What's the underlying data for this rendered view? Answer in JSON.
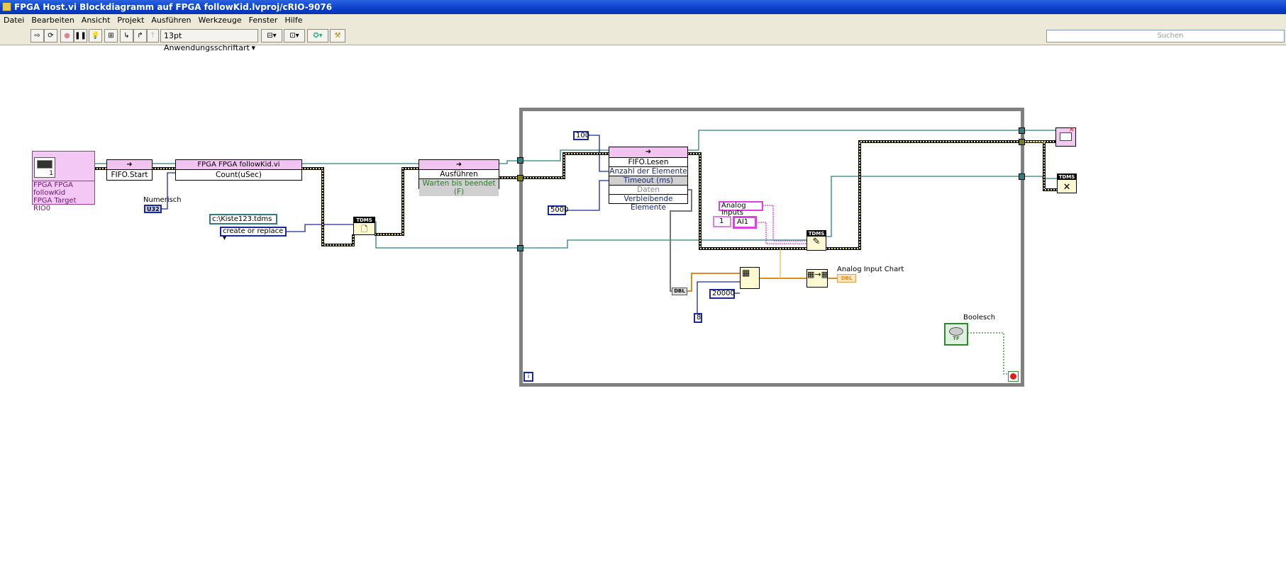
{
  "window": {
    "title": "FPGA Host.vi Blockdiagramm auf FPGA followKid.lvproj/cRIO-9076"
  },
  "menu": [
    "Datei",
    "Bearbeiten",
    "Ansicht",
    "Projekt",
    "Ausführen",
    "Werkzeuge",
    "Fenster",
    "Hilfe"
  ],
  "toolbar": {
    "font": "13pt Anwendungsschriftart",
    "search_placeholder": "Suchen"
  },
  "diagram": {
    "fpga_ref": {
      "line1": "FPGA FPGA followKid",
      "line2": "FPGA Target",
      "line3": "RIO0",
      "index": "1"
    },
    "fifo_start": {
      "label": "FIFO.Start"
    },
    "followkid": {
      "title": "FPGA FPGA followKid.vi",
      "row": "Count(uSec)"
    },
    "numerisch": {
      "label": "Numerisch",
      "type": "U32"
    },
    "path_const": "c:\\Kiste123.tdms",
    "enum_const": "create or replace",
    "tdms": "TDMS",
    "ausfuehren": {
      "label": "Ausführen",
      "row": "Warten bis beendet (F)"
    },
    "const_100": "100",
    "const_5000": "5000",
    "fifo_read": {
      "label": "FIFO.Lesen",
      "rows": [
        "Anzahl der Elemente",
        "Timeout (ms)",
        "Daten",
        "Verbleibende Elemente"
      ]
    },
    "analog_inputs": "Analog inputs",
    "const_1": "1",
    "ai1": "AI1",
    "dbl": "DBL",
    "const_20000": "20000",
    "const_8": "8",
    "chart": {
      "label": "Analog Input Chart",
      "type": "DBL"
    },
    "boolesch": {
      "label": "Boolesch",
      "type": "TF"
    },
    "loop_index": "i"
  },
  "colors": {
    "refnum": "#2f7f80",
    "error": "#c8c030",
    "numeric": "#1a2a9a",
    "dbl": "#e08a20",
    "string": "#e040e0"
  }
}
